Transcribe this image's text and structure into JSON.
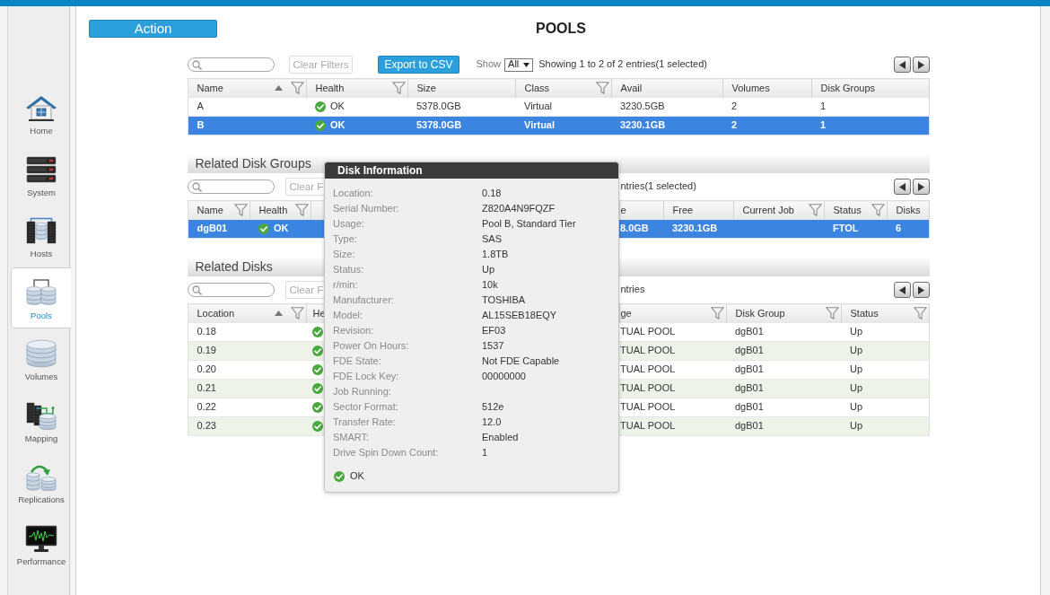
{
  "sidebar": {
    "items": [
      {
        "label": "Home",
        "selected": false
      },
      {
        "label": "System",
        "selected": false
      },
      {
        "label": "Hosts",
        "selected": false
      },
      {
        "label": "Pools",
        "selected": true
      },
      {
        "label": "Volumes",
        "selected": false
      },
      {
        "label": "Mapping",
        "selected": false
      },
      {
        "label": "Replications",
        "selected": false
      },
      {
        "label": "Performance",
        "selected": false
      }
    ]
  },
  "action_button": "Action",
  "page_title": "POOLS",
  "pools": {
    "toolbar": {
      "clear_filters": "Clear Filters",
      "export": "Export to CSV",
      "show_label": "Show",
      "show_value": "All",
      "summary": "Showing 1 to 2 of 2 entries(1 selected)"
    },
    "table": {
      "columns": [
        {
          "label": "Name",
          "sorted_ascending": true,
          "filter": true
        },
        {
          "label": "Health",
          "sorted_ascending": false,
          "filter": true
        },
        {
          "label": "Size",
          "sorted_ascending": false,
          "filter": false
        },
        {
          "label": "Class",
          "sorted_ascending": false,
          "filter": true
        },
        {
          "label": "Avail",
          "sorted_ascending": false,
          "filter": false
        },
        {
          "label": "Volumes",
          "sorted_ascending": false,
          "filter": false
        },
        {
          "label": "Disk Groups",
          "sorted_ascending": false,
          "filter": false
        }
      ],
      "rows": [
        {
          "selected": false,
          "cells": [
            "A",
            {
              "healthy": true,
              "text": "OK"
            },
            "5378.0GB",
            "Virtual",
            "3230.5GB",
            "2",
            "1"
          ]
        },
        {
          "selected": true,
          "cells": [
            "B",
            {
              "healthy": true,
              "text": "OK"
            },
            "5378.0GB",
            "Virtual",
            "3230.1GB",
            "2",
            "1"
          ]
        }
      ]
    }
  },
  "related_disk_groups": {
    "title": "Related Disk Groups",
    "toolbar": {
      "clear_filters": "Clear F",
      "summary": "ntries(1 selected)"
    },
    "table": {
      "columns": [
        {
          "label": "Name",
          "sorted_ascending": false,
          "filter": true
        },
        {
          "label": "Health",
          "sorted_ascending": false,
          "filter": true
        },
        {
          "label": "e",
          "sorted_ascending": false,
          "filter": false
        },
        {
          "label": "Free",
          "sorted_ascending": false,
          "filter": false
        },
        {
          "label": "Current Job",
          "sorted_ascending": false,
          "filter": true
        },
        {
          "label": "Status",
          "sorted_ascending": false,
          "filter": true
        },
        {
          "label": "Disks",
          "sorted_ascending": false,
          "filter": false
        }
      ],
      "rows": [
        {
          "selected": true,
          "cells": [
            "dgB01",
            {
              "healthy": true,
              "text": "OK"
            },
            "8.0GB",
            "3230.1GB",
            null,
            "FTOL",
            "6"
          ]
        }
      ]
    }
  },
  "related_disks": {
    "title": "Related Disks",
    "toolbar": {
      "clear_filters": "Clear F",
      "summary": "ntries"
    },
    "table": {
      "columns": [
        {
          "label": "Location",
          "sorted_ascending": true,
          "filter": true
        },
        {
          "label": "He",
          "sorted_ascending": false,
          "filter": false
        },
        {
          "label": "ge",
          "sorted_ascending": false,
          "filter": true
        },
        {
          "label": "Disk Group",
          "sorted_ascending": false,
          "filter": true
        },
        {
          "label": "Status",
          "sorted_ascending": false,
          "filter": true
        }
      ],
      "rows": [
        {
          "selected": false,
          "cells": [
            "0.18",
            {
              "healthy": true
            },
            "TUAL POOL",
            "dgB01",
            "Up"
          ]
        },
        {
          "selected": false,
          "cells": [
            "0.19",
            {
              "healthy": true
            },
            "TUAL POOL",
            "dgB01",
            "Up"
          ]
        },
        {
          "selected": false,
          "cells": [
            "0.20",
            {
              "healthy": true
            },
            "TUAL POOL",
            "dgB01",
            "Up"
          ]
        },
        {
          "selected": false,
          "cells": [
            "0.21",
            {
              "healthy": true
            },
            "TUAL POOL",
            "dgB01",
            "Up"
          ]
        },
        {
          "selected": false,
          "cells": [
            "0.22",
            {
              "healthy": true
            },
            "TUAL POOL",
            "dgB01",
            "Up"
          ]
        },
        {
          "selected": false,
          "cells": [
            "0.23",
            {
              "healthy": true
            },
            "TUAL POOL",
            "dgB01",
            "Up"
          ]
        }
      ]
    }
  },
  "disk_information": {
    "title": "Disk Information",
    "fields": [
      {
        "label": "Location:",
        "value": "0.18"
      },
      {
        "label": "Serial Number:",
        "value": "Z820A4N9FQZF"
      },
      {
        "label": "Usage:",
        "value": "Pool B, Standard Tier"
      },
      {
        "label": "Type:",
        "value": "SAS"
      },
      {
        "label": "Size:",
        "value": "1.8TB"
      },
      {
        "label": "Status:",
        "value": "Up"
      },
      {
        "label": "r/min:",
        "value": "10k"
      },
      {
        "label": "Manufacturer:",
        "value": "TOSHIBA"
      },
      {
        "label": "Model:",
        "value": "AL15SEB18EQY"
      },
      {
        "label": "Revision:",
        "value": "EF03"
      },
      {
        "label": "Power On Hours:",
        "value": "1537"
      },
      {
        "label": "FDE State:",
        "value": "Not FDE Capable"
      },
      {
        "label": "FDE Lock Key:",
        "value": "00000000"
      },
      {
        "label": "Job Running:"
      },
      {
        "label": "Sector Format:",
        "value": "512e"
      },
      {
        "label": "Transfer Rate:",
        "value": "12.0"
      },
      {
        "label": "SMART:",
        "value": "Enabled"
      },
      {
        "label": "Drive Spin Down Count:",
        "value": "1"
      }
    ],
    "footer": {
      "healthy": true,
      "text": "OK"
    }
  }
}
